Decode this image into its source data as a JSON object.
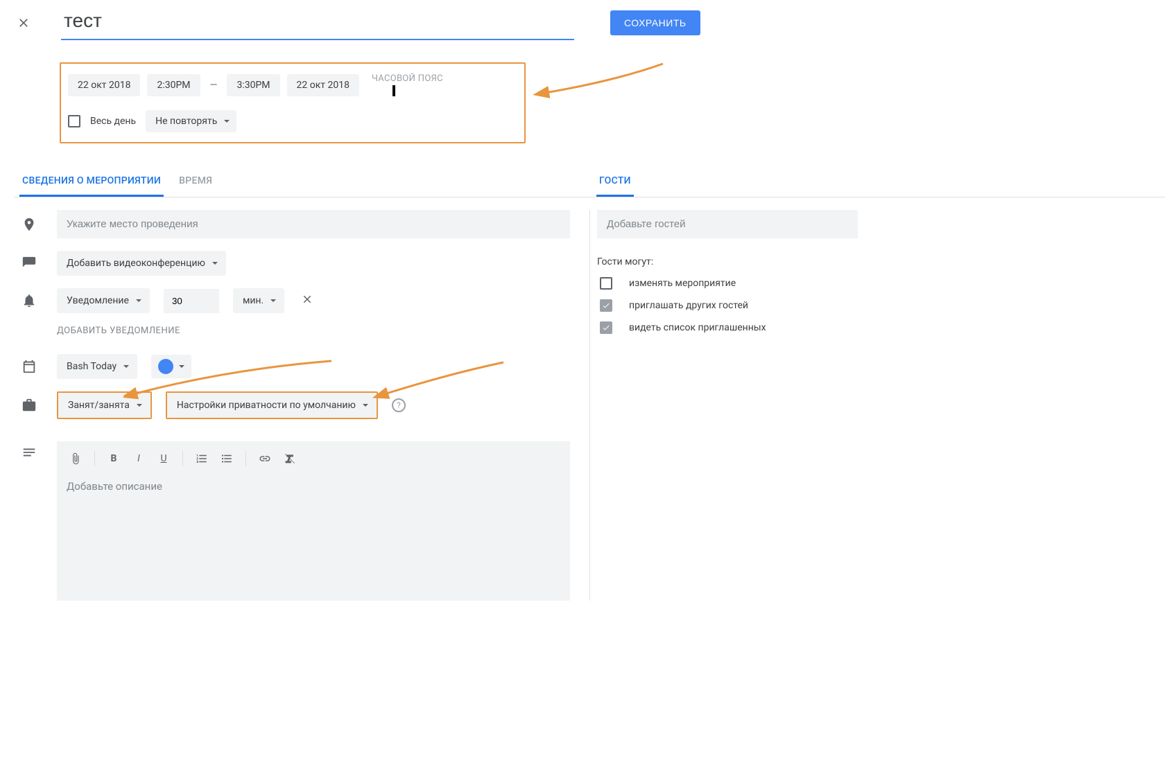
{
  "header": {
    "title_value": "тест",
    "save_label": "СОХРАНИТЬ"
  },
  "datetime": {
    "start_date": "22 окт 2018",
    "start_time": "2:30PM",
    "end_time": "3:30PM",
    "end_date": "22 окт 2018",
    "timezone_label": "ЧАСОВОЙ ПОЯС",
    "all_day_label": "Весь день",
    "repeat_label": "Не повторять"
  },
  "tabs": {
    "details": "СВЕДЕНИЯ О МЕРОПРИЯТИИ",
    "findtime": "ВРЕМЯ",
    "guests": "ГОСТИ"
  },
  "details": {
    "location_placeholder": "Укажите место проведения",
    "add_conference": "Добавить видеоконференцию",
    "notification": {
      "type": "Уведомление",
      "amount": "30",
      "unit": "мин."
    },
    "add_notification_label": "ДОБАВИТЬ УВЕДОМЛЕНИЕ",
    "calendar_name": "Bash Today",
    "busy_label": "Занят/занята",
    "visibility_label": "Настройки приватности по умолчанию",
    "description_placeholder": "Добавьте описание"
  },
  "guests": {
    "add_placeholder": "Добавьте гостей",
    "permissions_title": "Гости могут:",
    "perm_modify": "изменять мероприятие",
    "perm_invite": "приглашать других гостей",
    "perm_seeguests": "видеть список приглашенных"
  },
  "colors": {
    "accent": "#4285f4",
    "highlight": "#e8953e"
  }
}
